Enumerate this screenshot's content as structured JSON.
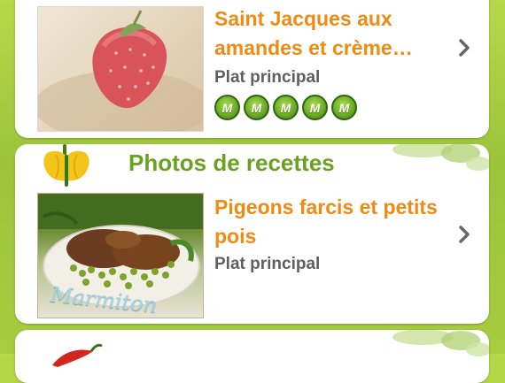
{
  "recipe_of_day": {
    "title": "Saint Jacques aux amandes et crème…",
    "category": "Plat principal",
    "rating": {
      "value": 5,
      "max": 5,
      "badge_letter": "M"
    }
  },
  "photos_section": {
    "heading": "Photos de recettes",
    "recipe": {
      "title": "Pigeons farcis et petits pois",
      "category": "Plat principal",
      "photo_watermark": "Marmiton"
    }
  },
  "colors": {
    "accent_orange": "#ef8a12",
    "section_green": "#6ba121",
    "background_green": "#a6cc3f"
  },
  "icons": {
    "chevron": "chevron-right-icon",
    "pepper": "yellow-pepper-icon",
    "chili": "red-chili-icon",
    "leaves": "leaves-icon"
  }
}
